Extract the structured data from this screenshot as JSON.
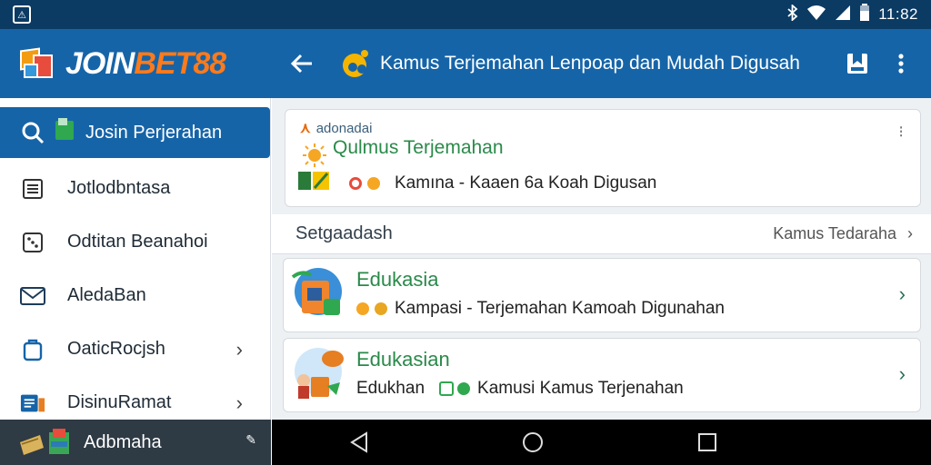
{
  "status": {
    "time": "11:82"
  },
  "brand": {
    "part1": "JOIN",
    "part2": "BET88"
  },
  "appbar": {
    "title": "Kamus Terjemahan Lenpoap dan Mudah Digusah"
  },
  "sidebar": {
    "items": [
      {
        "label": "Josin Perjerahan",
        "icon": "search-icon",
        "active": true
      },
      {
        "label": "Jotlodbntasa",
        "icon": "document-icon"
      },
      {
        "label": "Odtitan Beanahoi",
        "icon": "dice-icon"
      },
      {
        "label": "AledaBan",
        "icon": "mail-icon"
      },
      {
        "label": "OaticRocjsh",
        "icon": "bag-icon",
        "chevron": "›"
      },
      {
        "label": "DisinuRamat",
        "icon": "book-icon",
        "chevron": "›"
      }
    ],
    "footer_label": "Adbmaha"
  },
  "top_card": {
    "badge": "adonadai",
    "title": "Qulmus Terjemahan",
    "row": "Kamına - Kaaen 6a Koah Digusan",
    "menu": "⁝"
  },
  "section": {
    "title": "Setgaadash",
    "link": "Kamus Tedaraha"
  },
  "list": [
    {
      "title": "Edukasia",
      "sub": "Kampasi - Terjemahan  Kamoah Digunahan"
    },
    {
      "title": "Edukasian",
      "sub_prefix": "Edukhan",
      "sub": "Kamusi Kamus Terjenahan"
    }
  ],
  "colors": {
    "statusbar": "#0b3a63",
    "appbar": "#1664a8",
    "accent_green": "#2a8a4a",
    "brand_orange": "#ff7a1a"
  }
}
